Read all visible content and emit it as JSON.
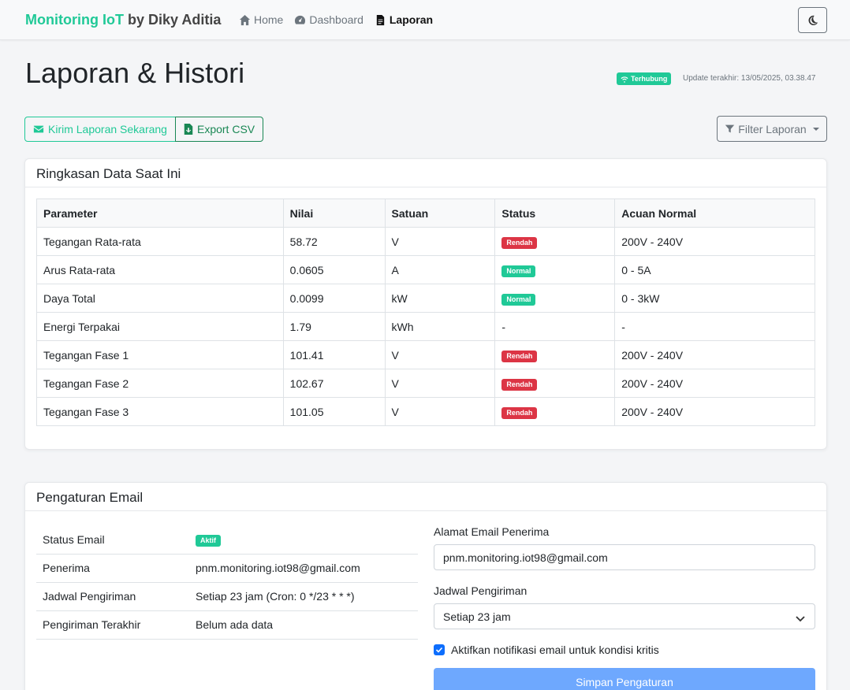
{
  "navbar": {
    "brand_accent": "Monitoring IoT",
    "brand_rest": " by Diky Aditia",
    "links": [
      {
        "label": "Home",
        "icon": "home-icon"
      },
      {
        "label": "Dashboard",
        "icon": "gauge-icon"
      },
      {
        "label": "Laporan",
        "icon": "file-icon"
      }
    ],
    "theme_toggle_icon": "moon-icon"
  },
  "header": {
    "title": "Laporan & Histori",
    "connection_badge": "Terhubung",
    "update_text": "Update terakhir: 13/05/2025, 03.38.47"
  },
  "actions": {
    "send_report": "Kirim Laporan Sekarang",
    "export_csv": "Export CSV",
    "filter": "Filter Laporan"
  },
  "summary": {
    "title": "Ringkasan Data Saat Ini",
    "columns": [
      "Parameter",
      "Nilai",
      "Satuan",
      "Status",
      "Acuan Normal"
    ],
    "rows": [
      {
        "parameter": "Tegangan Rata-rata",
        "nilai": "58.72",
        "satuan": "V",
        "status": "Rendah",
        "acuan": "200V - 240V"
      },
      {
        "parameter": "Arus Rata-rata",
        "nilai": "0.0605",
        "satuan": "A",
        "status": "Normal",
        "acuan": "0 - 5A"
      },
      {
        "parameter": "Daya Total",
        "nilai": "0.0099",
        "satuan": "kW",
        "status": "Normal",
        "acuan": "0 - 3kW"
      },
      {
        "parameter": "Energi Terpakai",
        "nilai": "1.79",
        "satuan": "kWh",
        "status": "-",
        "acuan": "-"
      },
      {
        "parameter": "Tegangan Fase 1",
        "nilai": "101.41",
        "satuan": "V",
        "status": "Rendah",
        "acuan": "200V - 240V"
      },
      {
        "parameter": "Tegangan Fase 2",
        "nilai": "102.67",
        "satuan": "V",
        "status": "Rendah",
        "acuan": "200V - 240V"
      },
      {
        "parameter": "Tegangan Fase 3",
        "nilai": "101.05",
        "satuan": "V",
        "status": "Rendah",
        "acuan": "200V - 240V"
      }
    ]
  },
  "email": {
    "title": "Pengaturan Email",
    "info": [
      {
        "label": "Status Email",
        "value": "Aktif",
        "badge": true
      },
      {
        "label": "Penerima",
        "value": "pnm.monitoring.iot98@gmail.com"
      },
      {
        "label": "Jadwal Pengiriman",
        "value": "Setiap 23 jam (Cron: 0 */23 * * *)"
      },
      {
        "label": "Pengiriman Terakhir",
        "value": "Belum ada data"
      }
    ],
    "form": {
      "email_label": "Alamat Email Penerima",
      "email_value": "pnm.monitoring.iot98@gmail.com",
      "schedule_label": "Jadwal Pengiriman",
      "schedule_value": "Setiap 23 jam",
      "notify_label": "Aktifkan notifikasi email untuk kondisi kritis",
      "notify_checked": true,
      "submit": "Simpan Pengaturan"
    }
  },
  "colors": {
    "accent": "#20c997",
    "danger": "#dc3545",
    "success": "#198754",
    "primary_light": "#6ea8fe"
  }
}
